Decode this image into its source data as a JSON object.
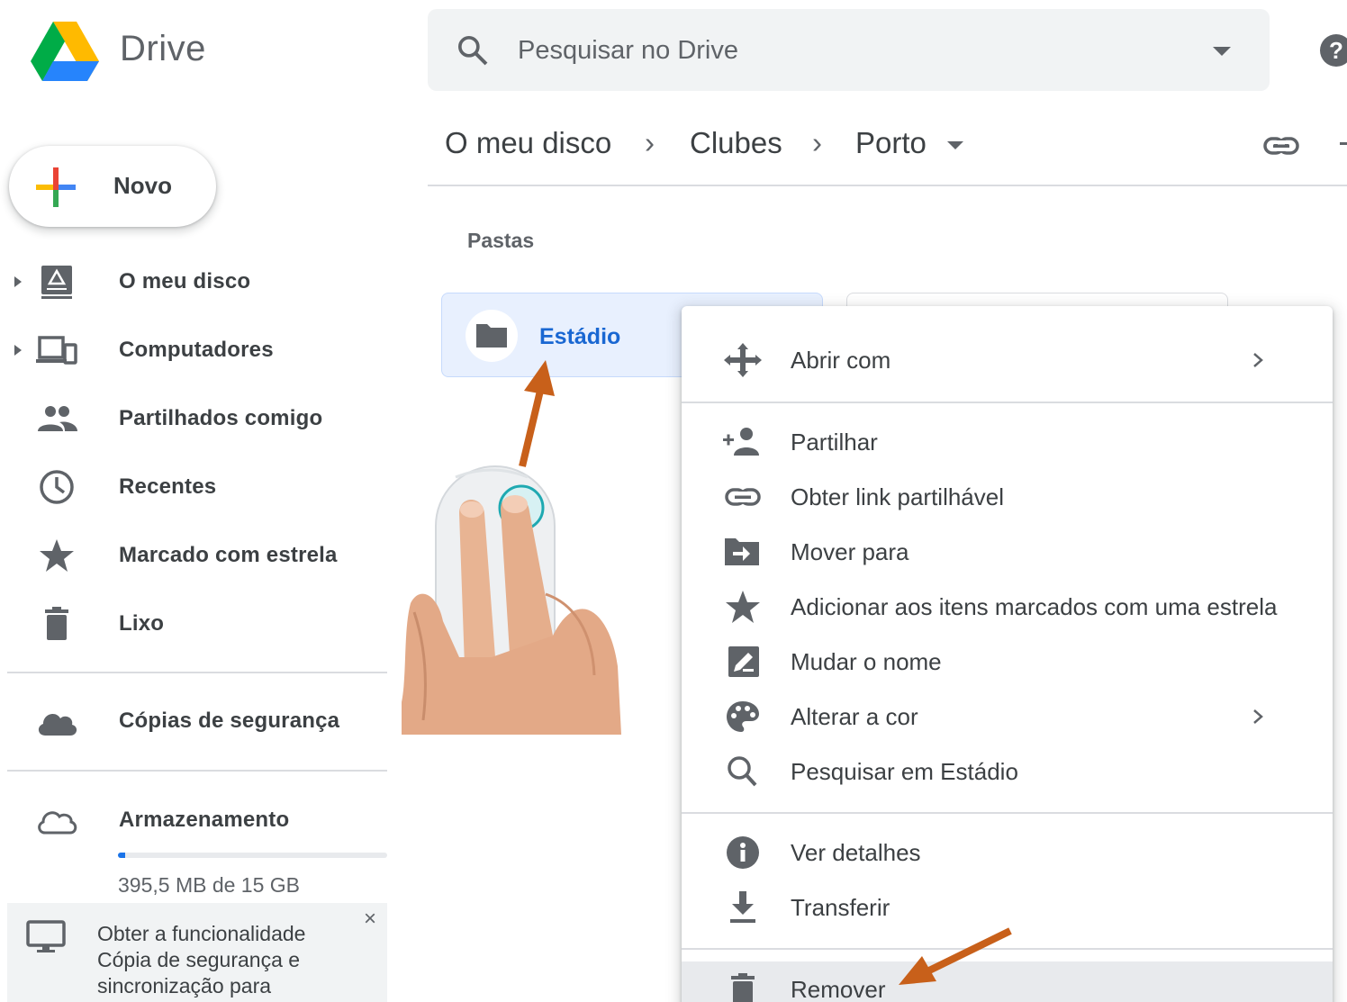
{
  "app": {
    "title": "Drive"
  },
  "search": {
    "placeholder": "Pesquisar no Drive"
  },
  "new_button": {
    "label": "Novo"
  },
  "sidebar": {
    "items": [
      {
        "label": "O meu disco",
        "icon": "my-drive-icon"
      },
      {
        "label": "Computadores",
        "icon": "computers-icon"
      },
      {
        "label": "Partilhados comigo",
        "icon": "shared-icon"
      },
      {
        "label": "Recentes",
        "icon": "clock-icon"
      },
      {
        "label": "Marcado com estrela",
        "icon": "star-icon"
      },
      {
        "label": "Lixo",
        "icon": "trash-icon"
      }
    ],
    "backups": {
      "label": "Cópias de segurança",
      "icon": "cloud-filled-icon"
    },
    "storage": {
      "label": "Armazenamento",
      "icon": "cloud-outline-icon",
      "used_text": "395,5 MB de 15 GB",
      "used_fraction": 0.026
    },
    "promo": {
      "text": "Obter a funcionalidade Cópia de segurança e sincronização para",
      "close": "×"
    }
  },
  "breadcrumb": {
    "items": [
      "O meu disco",
      "Clubes",
      "Porto"
    ],
    "separator": "›"
  },
  "section": {
    "folders_label": "Pastas"
  },
  "folders": [
    {
      "name": "Estádio"
    }
  ],
  "context_menu": {
    "groups": [
      [
        {
          "label": "Abrir com",
          "icon": "open-with-icon",
          "submenu": true
        }
      ],
      [
        {
          "label": "Partilhar",
          "icon": "share-person-icon"
        },
        {
          "label": "Obter link partilhável",
          "icon": "link-icon"
        },
        {
          "label": "Mover para",
          "icon": "move-to-icon"
        },
        {
          "label": "Adicionar aos itens marcados com uma estrela",
          "icon": "star-icon"
        },
        {
          "label": "Mudar o nome",
          "icon": "rename-icon"
        },
        {
          "label": "Alterar a cor",
          "icon": "palette-icon",
          "submenu": true
        },
        {
          "label": "Pesquisar em Estádio",
          "icon": "search-icon"
        }
      ],
      [
        {
          "label": "Ver detalhes",
          "icon": "info-icon"
        },
        {
          "label": "Transferir",
          "icon": "download-icon"
        }
      ],
      [
        {
          "label": "Remover",
          "icon": "trash-icon",
          "highlighted": true
        }
      ]
    ]
  },
  "colors": {
    "accent": "#1a73e8",
    "annotation_arrow": "#c8601a",
    "selected_bg": "#e8f0fe",
    "text_dark": "#3c4043"
  }
}
